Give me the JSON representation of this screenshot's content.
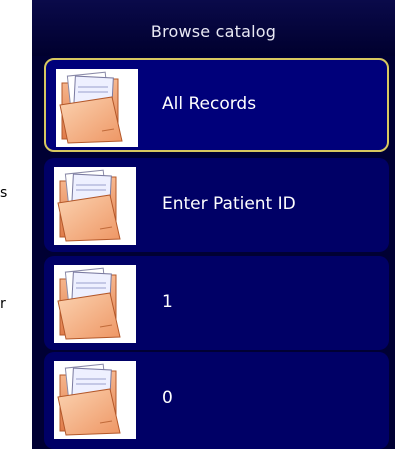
{
  "page": {
    "left_fragments": [
      "s",
      "r"
    ]
  },
  "catalog": {
    "title": "Browse catalog",
    "items": [
      {
        "label": "All Records",
        "icon": "folder-icon",
        "selected": true
      },
      {
        "label": "Enter Patient ID",
        "icon": "folder-icon",
        "selected": false
      },
      {
        "label": "1",
        "icon": "folder-icon",
        "selected": false
      },
      {
        "label": "0",
        "icon": "folder-icon",
        "selected": false
      }
    ]
  },
  "colors": {
    "panel_bg": "#000033",
    "item_bg": "#000066",
    "selected_border": "#d8c860",
    "folder_orange": "#f0a070",
    "text": "#ffffff"
  }
}
